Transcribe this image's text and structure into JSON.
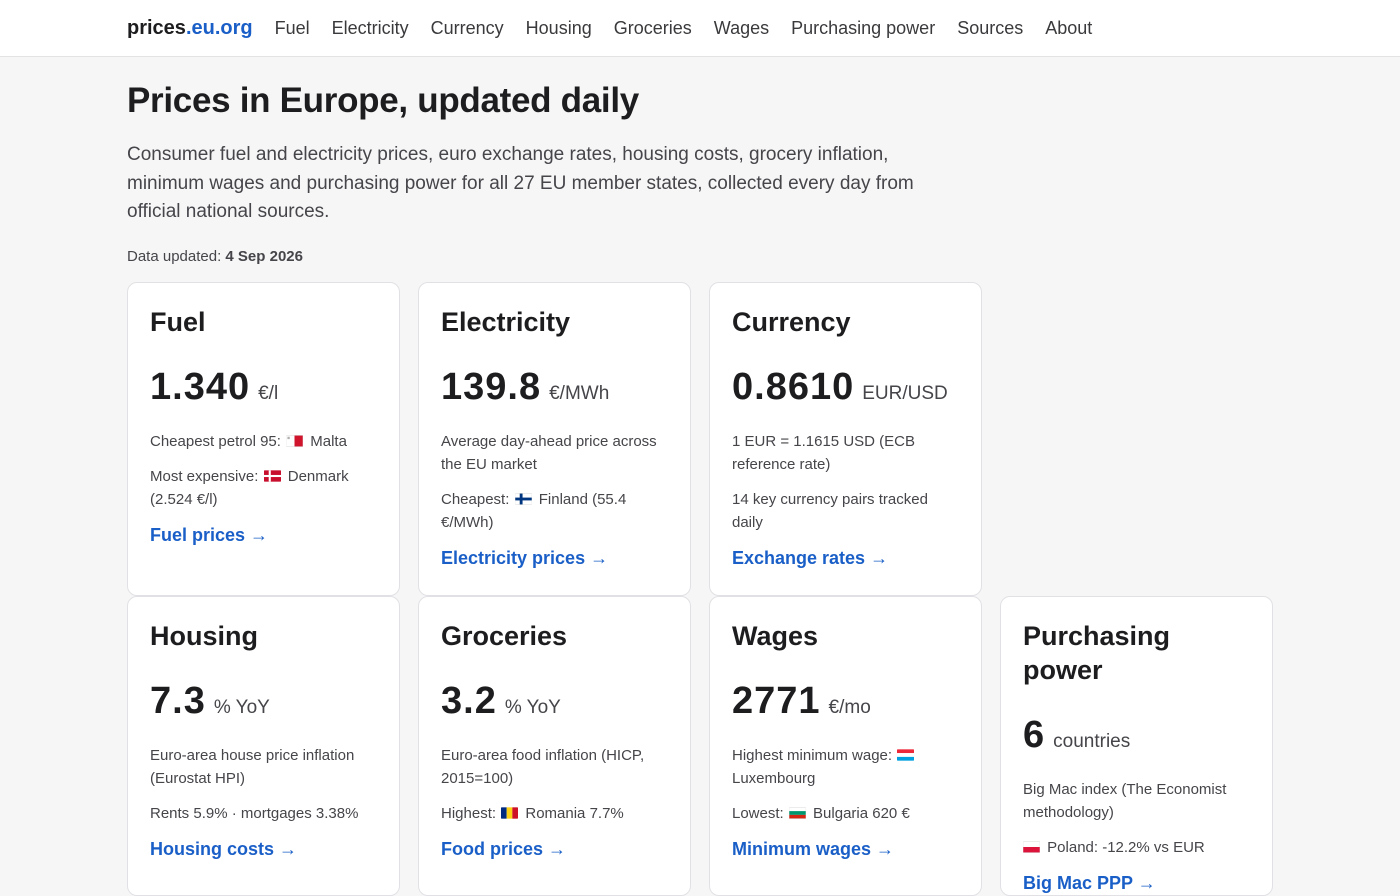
{
  "nav": {
    "brand_main": "prices",
    "brand_accent": ".eu.org",
    "links": [
      "Fuel",
      "Electricity",
      "Currency",
      "Housing",
      "Groceries",
      "Wages",
      "Purchasing power",
      "Sources",
      "About"
    ]
  },
  "hero": {
    "title": "Prices in Europe, updated daily",
    "intro": "Consumer fuel and electricity prices, euro exchange rates, housing costs, grocery inflation, minimum wages and purchasing power for all 27 EU member states, collected every day from official national sources.",
    "updated_label": "Data updated:",
    "updated_date": "4 Sep 2026"
  },
  "colors": {
    "accent": "#1a5fc7",
    "text": "#1d1d1f",
    "muted": "#45454a",
    "background": "#f6f6f7"
  },
  "cards": {
    "fuel": {
      "title": "Fuel",
      "value": "1.340",
      "unit": "€/l",
      "line1_pre": "Cheapest petrol 95:",
      "line1_country": "Malta",
      "line2_pre": "Most expensive:",
      "line2_country": "Denmark (2.524 €/l)",
      "link": "Fuel prices →"
    },
    "electricity": {
      "title": "Electricity",
      "value": "139.8",
      "unit": "€/MWh",
      "line1": "Average day-ahead price across the EU market",
      "line2_pre": "Cheapest:",
      "line2_country": "Finland (55.4 €/MWh)",
      "link": "Electricity prices →"
    },
    "currency": {
      "title": "Currency",
      "value": "0.8610",
      "unit": "EUR/USD",
      "line1": "1 EUR = 1.1615 USD (ECB reference rate)",
      "line2": "14 key currency pairs tracked daily",
      "link": "Exchange rates →"
    },
    "housing": {
      "title": "Housing",
      "value": "7.3",
      "unit": "% YoY",
      "line1": "Euro-area house price inflation (Eurostat HPI)",
      "line2": "Rents 5.9% · mortgages 3.38%",
      "link": "Housing costs →"
    },
    "groceries": {
      "title": "Groceries",
      "value": "3.2",
      "unit": "% YoY",
      "line1": "Euro-area food inflation (HICP, 2015=100)",
      "line2_pre": "Highest:",
      "line2_country": "Romania 7.7%",
      "link": "Food prices →"
    },
    "wages": {
      "title": "Wages",
      "value": "2771",
      "unit": "€/mo",
      "line1_pre": "Highest minimum wage:",
      "line1_country": "Luxembourg",
      "line2_pre": "Lowest:",
      "line2_country": "Bulgaria 620 €",
      "link": "Minimum wages →"
    },
    "ppp": {
      "title": "Purchasing power",
      "value": "6",
      "unit": "countries",
      "line1": "Big Mac index (The Economist methodology)",
      "line2_country": "Poland: -12.2% vs EUR",
      "link": "Big Mac PPP →"
    }
  }
}
